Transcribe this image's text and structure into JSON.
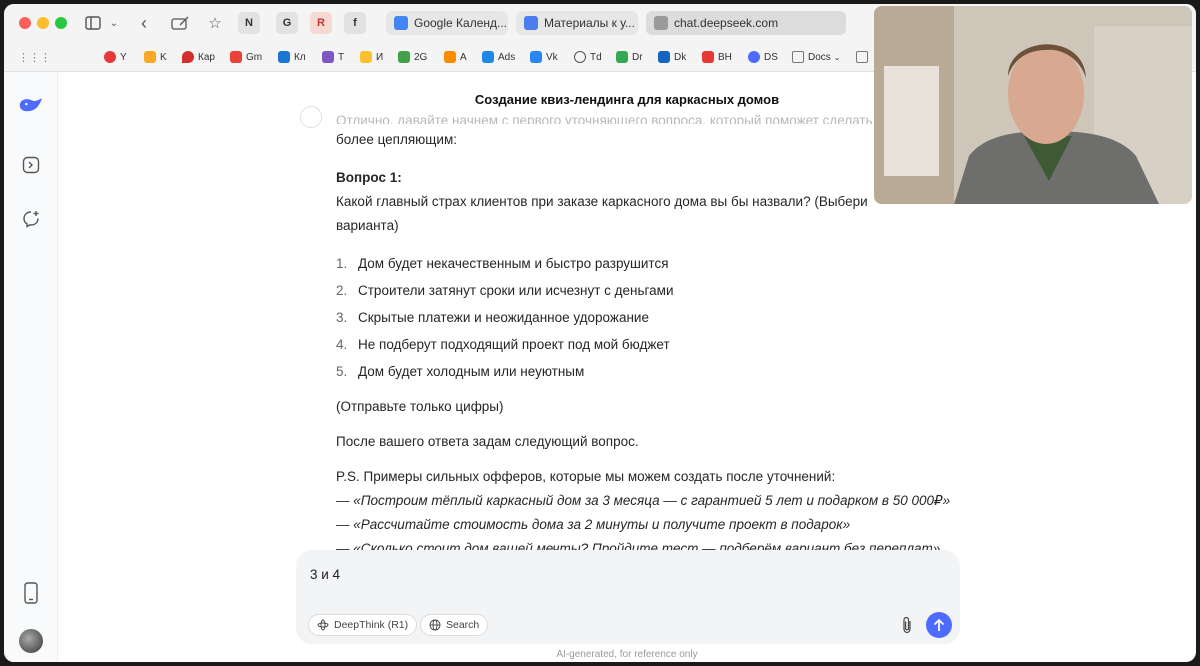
{
  "browser": {
    "tabs": [
      {
        "label": "Google Календ...",
        "color": "#4285f4"
      },
      {
        "label": "Материалы к у...",
        "color": "#4a7ef0"
      },
      {
        "label": "chat.deepseek.com",
        "color": "#555555"
      }
    ],
    "pinned": [
      "N",
      "G",
      "R",
      "f"
    ],
    "bookmarks": [
      {
        "label": "Y",
        "color": "#e53935"
      },
      {
        "label": "K",
        "color": "#f9a825"
      },
      {
        "label": "Кар",
        "color": "#d32f2f"
      },
      {
        "label": "Gm",
        "color": "#ea4335"
      },
      {
        "label": "Кл",
        "color": "#1976d2"
      },
      {
        "label": "Т",
        "color": "#7e57c2"
      },
      {
        "label": "И",
        "color": "#fbc02d"
      },
      {
        "label": "2G",
        "color": "#43a047"
      },
      {
        "label": "А",
        "color": "#fb8c00"
      },
      {
        "label": "Ads",
        "color": "#1e88e5"
      },
      {
        "label": "Vk",
        "color": "#2787f5"
      },
      {
        "label": "Td",
        "color": "#555555"
      },
      {
        "label": "Dr",
        "color": "#34a853"
      },
      {
        "label": "Dk",
        "color": "#1565c0"
      },
      {
        "label": "ВН",
        "color": "#e53935"
      },
      {
        "label": "DS",
        "color": "#4d6bfe"
      },
      {
        "label": "Docs",
        "color": "#777777"
      }
    ]
  },
  "chat": {
    "title": "Создание квиз-лендинга для каркасных домов",
    "faded_line": "Отлично, давайте начнем с первого уточняющего вопроса, который поможет сделать",
    "intro_tail": "более цепляющим:",
    "question_title": "Вопрос 1:",
    "question_text": "Какой главный страх клиентов при заказе каркасного дома вы бы назвали? (Выбери",
    "question_tail": "варианта)",
    "options": [
      "Дом будет некачественным и быстро разрушится",
      "Строители затянут сроки или исчезнут с деньгами",
      "Скрытые платежи и неожиданное удорожание",
      "Не подберут подходящий проект под мой бюджет",
      "Дом будет холодным или неуютным"
    ],
    "numbers_hint": "(Отправьте только цифры)",
    "after_answer": "После вашего ответа задам следующий вопрос.",
    "ps": "P.S. Примеры сильных офферов, которые мы можем создать после уточнений:",
    "offers": [
      "— «Построим тёплый каркасный дом за 3 месяца — с гарантией 5 лет и подарком в 50 000₽»",
      "— «Рассчитайте стоимость дома за 2 минуты и получите проект в подарок»",
      "— «Сколько стоит дом вашей мечты? Пройдите тест — подберём вариант без переплат»"
    ]
  },
  "input": {
    "value": "3 и 4",
    "deepthink_label": "DeepThink (R1)",
    "search_label": "Search"
  },
  "disclaimer": "AI-generated, for reference only",
  "colors": {
    "accent": "#4d6bfe"
  }
}
